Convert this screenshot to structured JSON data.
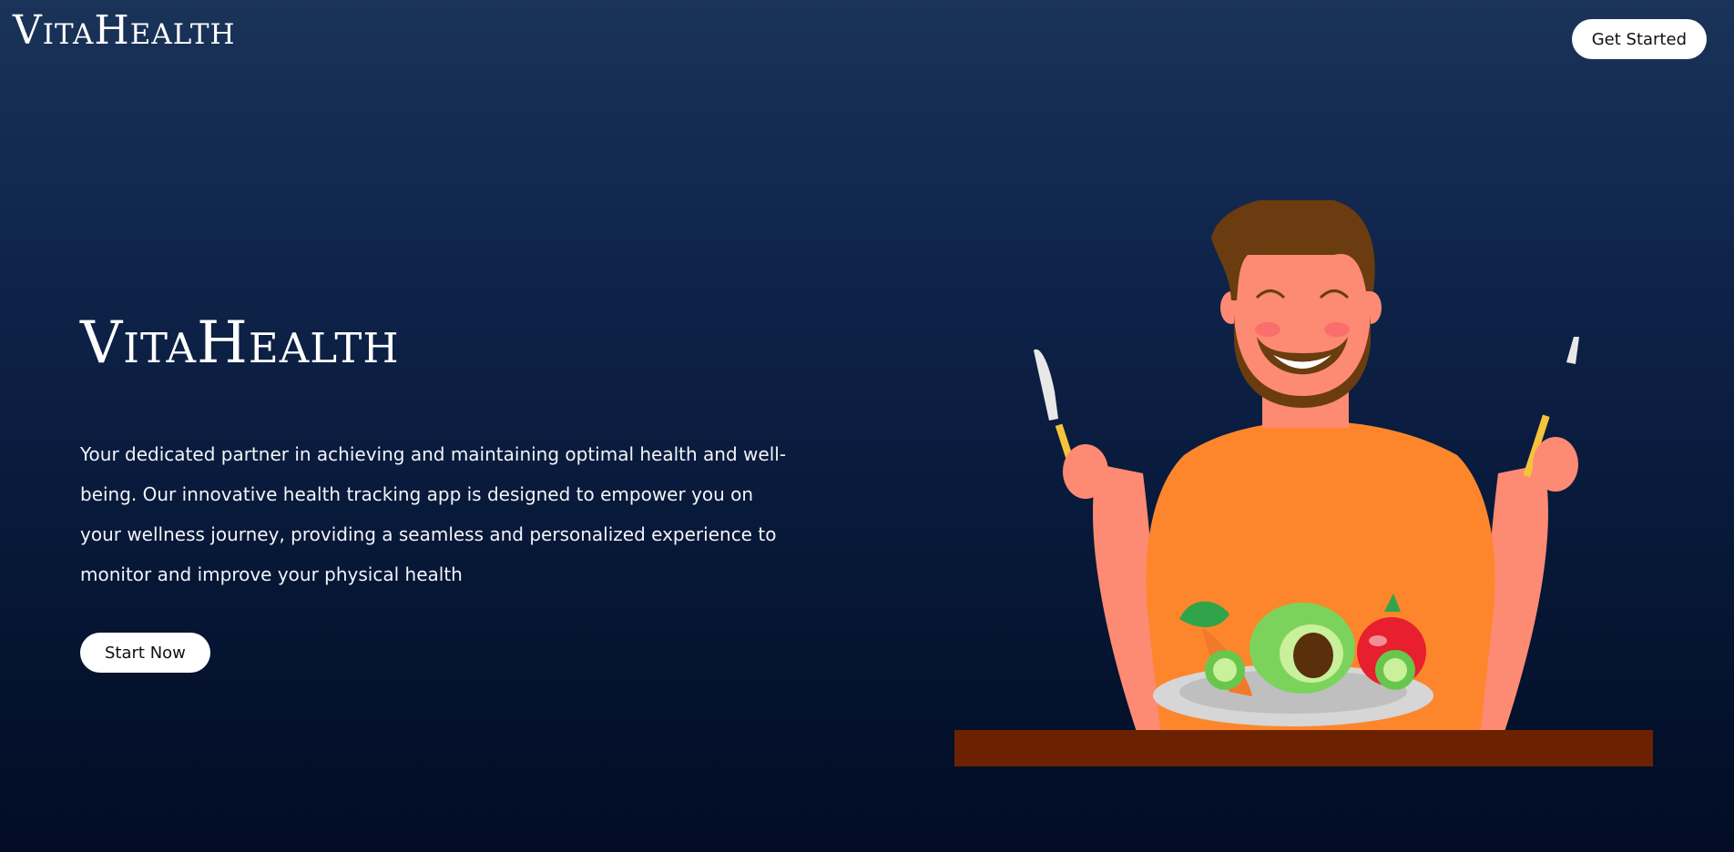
{
  "header": {
    "brand_first": "V",
    "brand_rest_a": "ita",
    "brand_mid": "H",
    "brand_rest_b": "ealth",
    "cta_label": "Get Started"
  },
  "hero": {
    "title_first": "V",
    "title_rest_a": "ita",
    "title_mid": "H",
    "title_rest_b": "ealth",
    "description": "Your dedicated partner in achieving and maintaining optimal health and well-being. Our innovative health tracking app is designed to empower you on your wellness journey, providing a seamless and personalized experience to monitor and improve your physical health",
    "button_label": "Start Now"
  },
  "illustration": {
    "subject": "man-eating-salad-icon",
    "colors": {
      "skin": "#fd8a72",
      "shirt": "#fd862c",
      "hair": "#6a3c10",
      "table": "#6c2200",
      "plate": "#d6d6d6"
    }
  }
}
